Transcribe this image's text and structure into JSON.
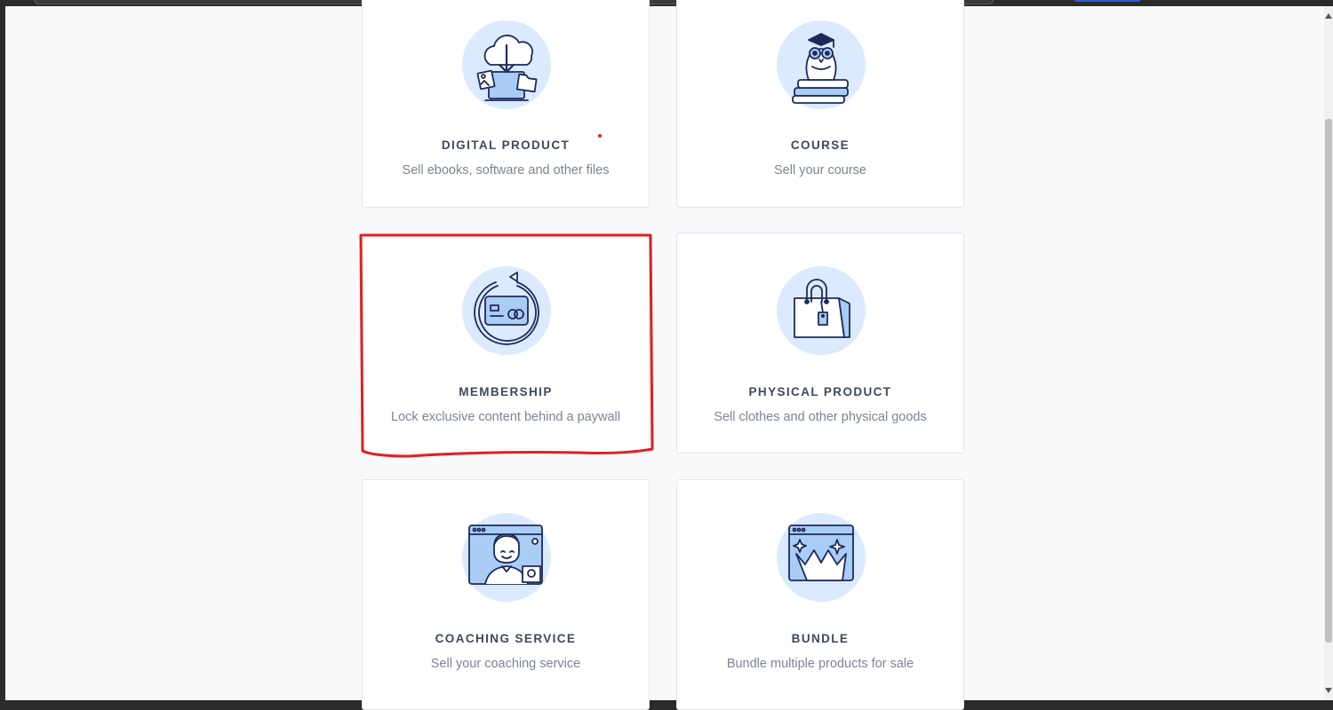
{
  "cards": [
    {
      "title": "DIGITAL PRODUCT",
      "description": "Sell ebooks, software and other files",
      "icon": "cloud-download-laptop-icon"
    },
    {
      "title": "COURSE",
      "description": "Sell your course",
      "icon": "owl-books-icon"
    },
    {
      "title": "MEMBERSHIP",
      "description": "Lock exclusive content behind a paywall",
      "icon": "recurring-card-icon"
    },
    {
      "title": "PHYSICAL PRODUCT",
      "description": "Sell clothes and other physical goods",
      "icon": "shopping-bag-icon"
    },
    {
      "title": "COACHING SERVICE",
      "description": "Sell your coaching service",
      "icon": "video-call-icon"
    },
    {
      "title": "BUNDLE",
      "description": "Bundle multiple products for sale",
      "icon": "crown-window-icon"
    }
  ],
  "colors": {
    "icon_bg": "#dbeafe",
    "icon_stroke": "#1e2a5a",
    "icon_fill": "#a9cdf5",
    "annotation": "#e02020"
  }
}
